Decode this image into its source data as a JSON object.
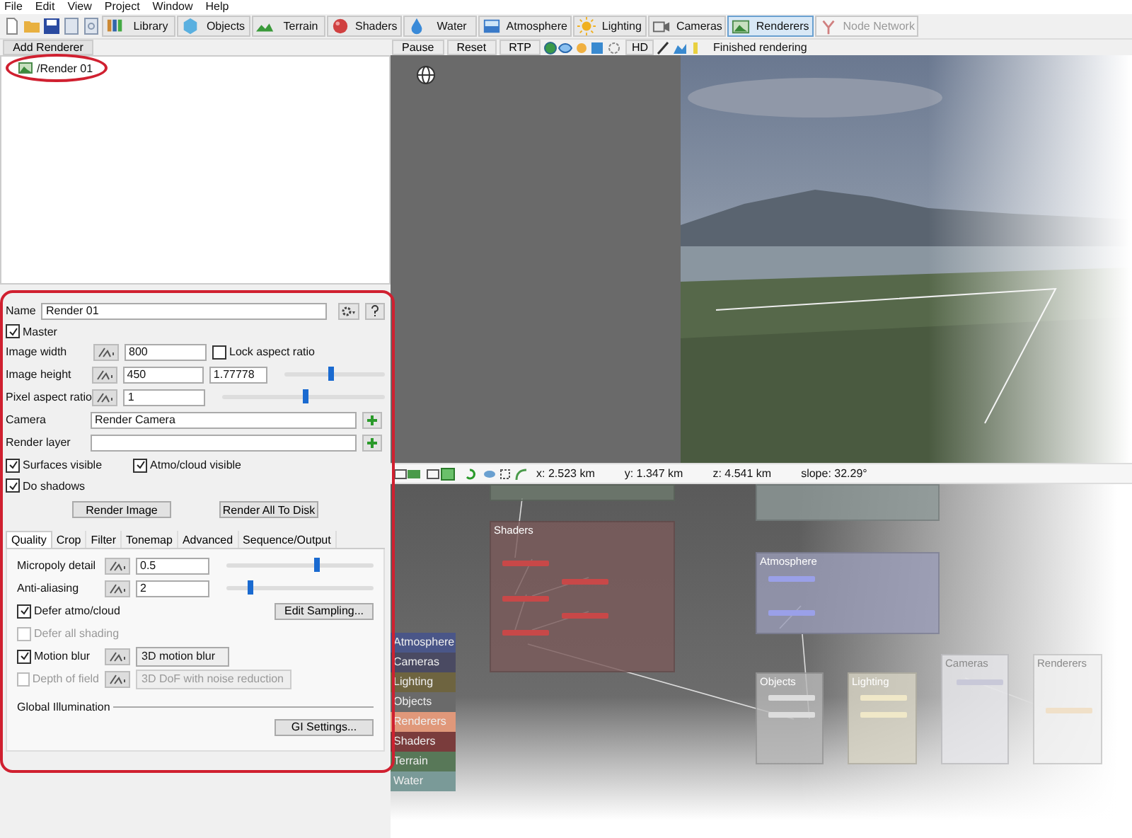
{
  "menu": [
    {
      "label": "File"
    },
    {
      "label": "Edit"
    },
    {
      "label": "View"
    },
    {
      "label": "Project"
    },
    {
      "label": "Window"
    },
    {
      "label": "Help"
    }
  ],
  "toolbar": {
    "tabs": [
      {
        "label": "Library",
        "selected": false,
        "disabled": false
      },
      {
        "label": "Objects",
        "selected": false,
        "disabled": false
      },
      {
        "label": "Terrain",
        "selected": false,
        "disabled": false
      },
      {
        "label": "Shaders",
        "selected": false,
        "disabled": false
      },
      {
        "label": "Water",
        "selected": false,
        "disabled": false
      },
      {
        "label": "Atmosphere",
        "selected": false,
        "disabled": false
      },
      {
        "label": "Lighting",
        "selected": false,
        "disabled": false
      },
      {
        "label": "Cameras",
        "selected": false,
        "disabled": false
      },
      {
        "label": "Renderers",
        "selected": true,
        "disabled": false
      },
      {
        "label": "Node Network",
        "selected": false,
        "disabled": true
      }
    ]
  },
  "renderer_list": {
    "add_button": "Add Renderer",
    "items": [
      {
        "label": "/Render 01"
      }
    ]
  },
  "properties": {
    "name": {
      "label": "Name",
      "value": "Render 01"
    },
    "master": {
      "label": "Master",
      "checked": true
    },
    "image_width": {
      "label": "Image width",
      "value": "800"
    },
    "lock_aspect": {
      "label": "Lock aspect ratio",
      "checked": false
    },
    "image_height": {
      "label": "Image height",
      "value": "450",
      "ratio": "1.77778",
      "level": 0.46
    },
    "pixel_aspect": {
      "label": "Pixel aspect ratio",
      "value": "1",
      "level": 0.51
    },
    "camera": {
      "label": "Camera",
      "value": "Render Camera"
    },
    "render_layer": {
      "label": "Render layer"
    },
    "surfaces_visible": {
      "label": "Surfaces visible",
      "checked": true
    },
    "atmo_visible": {
      "label": "Atmo/cloud visible",
      "checked": true
    },
    "do_shadows": {
      "label": "Do shadows",
      "checked": true
    },
    "buttons": [
      "Render Image",
      "Render All To Disk"
    ]
  },
  "settings_tabs": [
    {
      "label": "Quality",
      "selected": true
    },
    {
      "label": "Crop",
      "selected": false
    },
    {
      "label": "Filter",
      "selected": false
    },
    {
      "label": "Tonemap",
      "selected": false
    },
    {
      "label": "Advanced",
      "selected": false
    },
    {
      "label": "Sequence/Output",
      "selected": false
    }
  ],
  "quality": {
    "micropoly": {
      "label": "Micropoly detail",
      "value": "0.5",
      "level": 0.62
    },
    "anti_aliasing": {
      "label": "Anti-aliasing",
      "value": "2",
      "level": 0.16
    },
    "defer_atmo": {
      "label": "Defer atmo/cloud",
      "checked": true,
      "disabled": false
    },
    "edit_sampling": "Edit Sampling...",
    "defer_all": {
      "label": "Defer all shading",
      "checked": false,
      "disabled": true
    },
    "motion_blur": {
      "label": "Motion blur",
      "checked": true,
      "option": "3D motion blur",
      "disabled": false
    },
    "depth_of_field": {
      "label": "Depth of field",
      "checked": false,
      "option": "3D DoF with noise reduction",
      "disabled": true
    },
    "gi_label": "Global Illumination",
    "gi_button": "GI Settings..."
  },
  "render_toolbar": {
    "buttons": [
      "Pause",
      "Reset",
      "RTP"
    ],
    "hd": "HD",
    "status": "Finished rendering"
  },
  "node_toolbar": {
    "readouts": [
      "x: 2.523 km",
      "y: 1.347 km",
      "z: 4.541 km",
      "slope: 32.29°"
    ]
  },
  "node_groups": [
    {
      "color": "#6e7a6e"
    },
    {
      "color": "#8e9a98"
    },
    {
      "title": "Shaders",
      "color": "#7a5a5a"
    },
    {
      "title": "Atmosphere",
      "color": "#9a9cb8"
    },
    {
      "title": "Objects",
      "color": "#b8b8b8"
    },
    {
      "title": "Lighting",
      "color": "#d8d4c4"
    },
    {
      "title": "Cameras",
      "color": "#e6e6ea"
    },
    {
      "title": "Renderers",
      "color": "#f0f0f0"
    }
  ],
  "legend": [
    {
      "label": "Atmosphere",
      "color": "#4a5688"
    },
    {
      "label": "Cameras",
      "color": "#4a4a62"
    },
    {
      "label": "Lighting",
      "color": "#6e6440"
    },
    {
      "label": "Objects",
      "color": "#6a6a6a"
    },
    {
      "label": "Renderers",
      "color": "#e0987a"
    },
    {
      "label": "Shaders",
      "color": "#7a3c3c"
    },
    {
      "label": "Terrain",
      "color": "#587858"
    },
    {
      "label": "Water",
      "color": "#7a9a98"
    }
  ]
}
